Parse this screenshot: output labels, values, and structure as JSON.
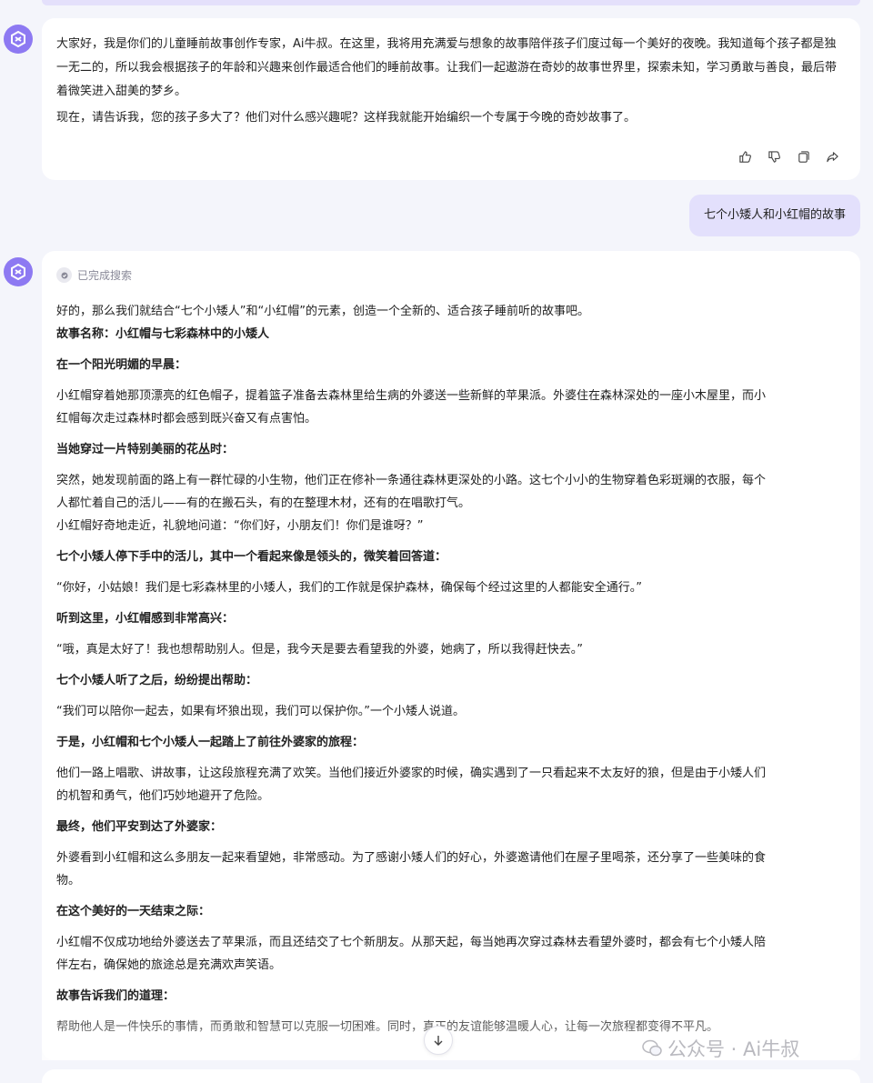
{
  "message1": {
    "paragraphs": [
      "大家好，我是你们的儿童睡前故事创作专家，Ai牛叔。在这里，我将用充满爱与想象的故事陪伴孩子们度过每一个美好的夜晚。我知道每",
      "个孩子都是独一无二的，所以我会根据孩子的年龄和兴趣来创作最适合他们的睡前故事。让我们一起遨游在奇妙的故事世界里，探索未",
      "知，学习勇敢与善良，最后带着微笑进入甜美的梦乡。"
    ],
    "question": "现在，请告诉我，您的孩子多大了？他们对什么感兴趣呢？这样我就能开始编织一个专属于今晚的奇妙故事了。",
    "actions": [
      "thumbs-up-icon",
      "thumbs-down-icon",
      "copy-icon",
      "share-icon"
    ]
  },
  "user_message": "七个小矮人和小红帽的故事",
  "message2": {
    "search_status": "已完成搜索",
    "lines": [
      {
        "text": "好的，那么我们就结合“七个小矮人”和“小红帽”的元素，创造一个全新的、适合孩子睡前听的故事吧。",
        "bold": false
      },
      {
        "text": "故事名称：小红帽与七彩森林中的小矮人",
        "bold": true
      },
      {
        "text": "在一个阳光明媚的早晨：",
        "bold": true
      },
      {
        "text": "小红帽穿着她那顶漂亮的红色帽子，提着篮子准备去森林里给生病的外婆送一些新鲜的苹果派。外婆住在森林深处的一座小木屋里，而小",
        "bold": false
      },
      {
        "text": "红帽每次走过森林时都会感到既兴奋又有点害怕。",
        "bold": false
      },
      {
        "text": "当她穿过一片特别美丽的花丛时：",
        "bold": true
      },
      {
        "text": "突然，她发现前面的路上有一群忙碌的小生物，他们正在修补一条通往森林更深处的小路。这七个小小的生物穿着色彩斑斓的衣服，每个",
        "bold": false
      },
      {
        "text": "人都忙着自己的活儿——有的在搬石头，有的在整理木材，还有的在唱歌打气。",
        "bold": false
      },
      {
        "text": "小红帽好奇地走近，礼貌地问道：“你们好，小朋友们！你们是谁呀？”",
        "bold": false
      },
      {
        "text": "七个小矮人停下手中的活儿，其中一个看起来像是领头的，微笑着回答道：",
        "bold": true
      },
      {
        "text": "“你好，小姑娘！我们是七彩森林里的小矮人，我们的工作就是保护森林，确保每个经过这里的人都能安全通行。”",
        "bold": false
      },
      {
        "text": "听到这里，小红帽感到非常高兴：",
        "bold": true
      },
      {
        "text": "“哦，真是太好了！我也想帮助别人。但是，我今天是要去看望我的外婆，她病了，所以我得赶快去。”",
        "bold": false
      },
      {
        "text": "七个小矮人听了之后，纷纷提出帮助：",
        "bold": true
      },
      {
        "text": "“我们可以陪你一起去，如果有坏狼出现，我们可以保护你。”一个小矮人说道。",
        "bold": false
      },
      {
        "text": "于是，小红帽和七个小矮人一起踏上了前往外婆家的旅程：",
        "bold": true
      },
      {
        "text": "他们一路上唱歌、讲故事，让这段旅程充满了欢笑。当他们接近外婆家的时候，确实遇到了一只看起来不太友好的狼，但是由于小矮人们",
        "bold": false
      },
      {
        "text": "的机智和勇气，他们巧妙地避开了危险。",
        "bold": false
      },
      {
        "text": "最终，他们平安到达了外婆家：",
        "bold": true
      },
      {
        "text": "外婆看到小红帽和这么多朋友一起来看望她，非常感动。为了感谢小矮人们的好心，外婆邀请他们在屋子里喝茶，还分享了一些美味的食",
        "bold": false
      },
      {
        "text": "物。",
        "bold": false
      },
      {
        "text": "在这个美好的一天结束之际：",
        "bold": true
      },
      {
        "text": "小红帽不仅成功地给外婆送去了苹果派，而且还结交了七个新朋友。从那天起，每当她再次穿过森林去看望外婆时，都会有七个小矮人陪",
        "bold": false
      },
      {
        "text": "伴左右，确保她的旅途总是充满欢声笑语。",
        "bold": false
      },
      {
        "text": "故事告诉我们的道理：",
        "bold": true
      },
      {
        "text": "帮助他人是一件快乐的事情，而勇敢和智慧可以克服一切困难。同时，真正的友谊能够温暖人心，让每一次旅程都变得不平凡。",
        "bold": false
      }
    ]
  },
  "watermark": "公众号 · Ai牛叔"
}
